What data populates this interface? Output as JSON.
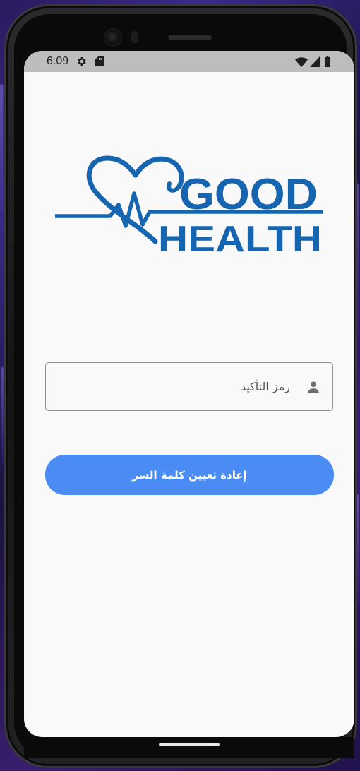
{
  "status_bar": {
    "time": "6:09",
    "icons": [
      "settings-gear-icon",
      "sd-card-icon",
      "wifi-icon",
      "cellular-signal-icon",
      "battery-icon"
    ]
  },
  "logo": {
    "line1": "GOOD",
    "line2": "HEALTH",
    "icon": "heart-pulse-icon",
    "color": "#1565b0"
  },
  "form": {
    "code_field": {
      "placeholder": "رمز التأكيد",
      "value": "",
      "icon": "person-icon"
    },
    "reset_button_label": "إعادة تعيين كلمة السر"
  },
  "colors": {
    "accent": "#4a8cf4",
    "background": "#f9f9f9",
    "status_bar": "#bdbdbd",
    "logo_blue": "#1565b0"
  }
}
